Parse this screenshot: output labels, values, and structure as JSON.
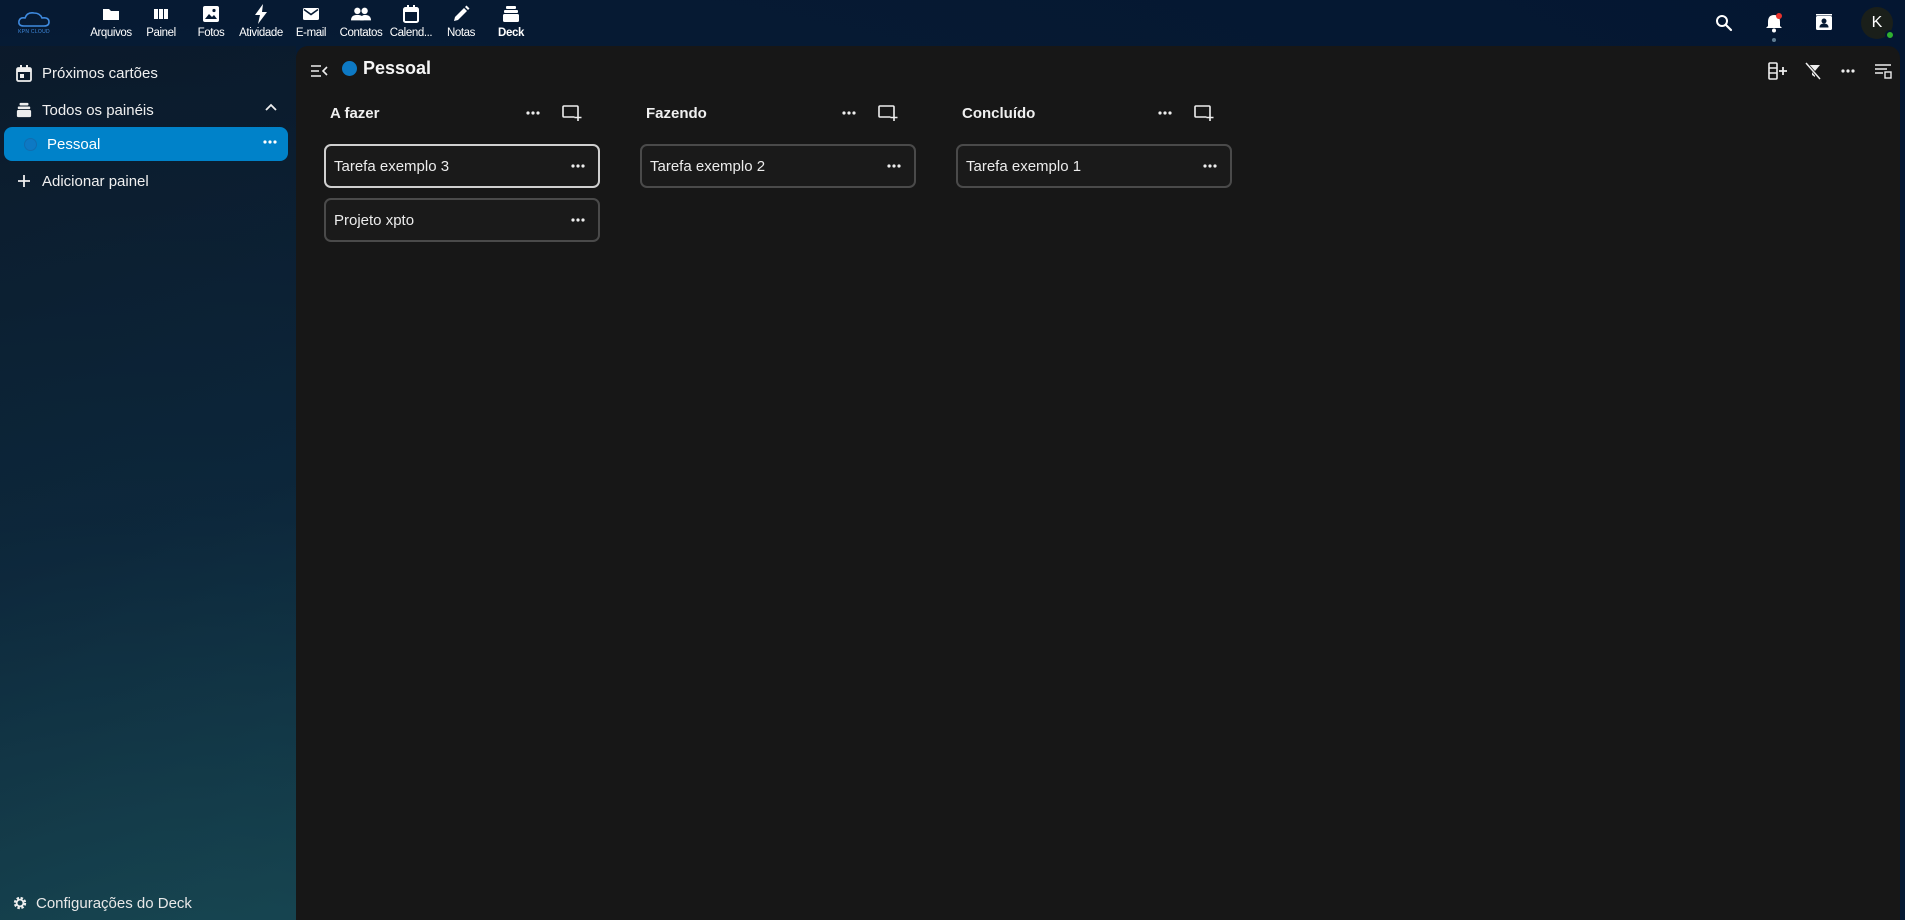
{
  "header": {
    "logo_text": "KPN CLOUD",
    "apps": [
      {
        "label": "Arquivos",
        "icon": "folder-icon"
      },
      {
        "label": "Painel",
        "icon": "dashboard-icon"
      },
      {
        "label": "Fotos",
        "icon": "image-icon"
      },
      {
        "label": "Atividade",
        "icon": "lightning-icon"
      },
      {
        "label": "E-mail",
        "icon": "mail-icon"
      },
      {
        "label": "Contatos",
        "icon": "contacts-icon"
      },
      {
        "label": "Calend...",
        "icon": "calendar-icon"
      },
      {
        "label": "Notas",
        "icon": "pencil-icon"
      },
      {
        "label": "Deck",
        "icon": "deck-icon",
        "active": true
      }
    ],
    "avatar_initial": "K"
  },
  "sidebar": {
    "upcoming": "Próximos cartões",
    "all_boards": "Todos os painéis",
    "boards": [
      {
        "label": "Pessoal",
        "color": "#0d79c4"
      }
    ],
    "add_board": "Adicionar painel",
    "settings": "Configurações do Deck"
  },
  "board": {
    "title": "Pessoal",
    "color": "#0d79c4",
    "stacks": [
      {
        "title": "A fazer",
        "cards": [
          "Tarefa exemplo 3",
          "Projeto xpto"
        ]
      },
      {
        "title": "Fazendo",
        "cards": [
          "Tarefa exemplo 2"
        ]
      },
      {
        "title": "Concluído",
        "cards": [
          "Tarefa exemplo 1"
        ]
      }
    ]
  },
  "colors": {
    "accent": "#0082c9",
    "main_bg": "#171717",
    "card_border": "#4a4a4a"
  }
}
